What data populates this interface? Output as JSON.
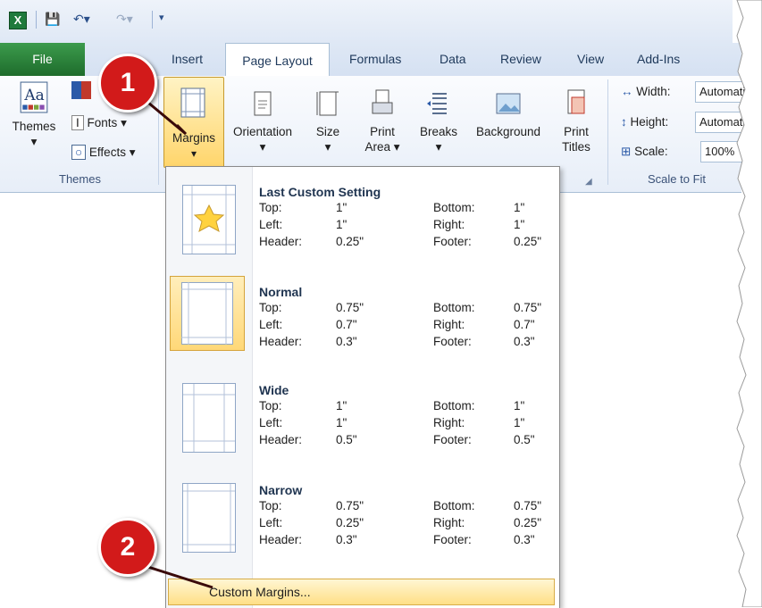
{
  "quick_access": {
    "excel_icon": "excel-icon",
    "save_icon": "save-icon",
    "undo_icon": "undo-icon",
    "redo_icon": "redo-icon"
  },
  "tabs": [
    "File",
    "Insert",
    "Page Layout",
    "Formulas",
    "Data",
    "Review",
    "View",
    "Add-Ins"
  ],
  "ribbon": {
    "themes": {
      "label": "Themes",
      "group": "Themes",
      "fonts": "Fonts",
      "effects": "Effects"
    },
    "margins": "Margins",
    "orientation": "Orientation",
    "size": "Size",
    "print_area": {
      "line1": "Print",
      "line2": "Area"
    },
    "breaks": "Breaks",
    "background": "Background",
    "print_titles": {
      "line1": "Print",
      "line2": "Titles"
    },
    "scale_to_fit": {
      "group": "Scale to Fit",
      "width_label": "Width:",
      "width_value": "Automati",
      "height_label": "Height:",
      "height_value": "Automati",
      "scale_label": "Scale:",
      "scale_value": "100%"
    }
  },
  "margins_menu": {
    "options": [
      {
        "name": "Last Custom Setting",
        "top": "1\"",
        "bottom": "1\"",
        "left": "1\"",
        "right": "1\"",
        "header": "0.25\"",
        "footer": "0.25\""
      },
      {
        "name": "Normal",
        "top": "0.75\"",
        "bottom": "0.75\"",
        "left": "0.7\"",
        "right": "0.7\"",
        "header": "0.3\"",
        "footer": "0.3\""
      },
      {
        "name": "Wide",
        "top": "1\"",
        "bottom": "1\"",
        "left": "1\"",
        "right": "1\"",
        "header": "0.5\"",
        "footer": "0.5\""
      },
      {
        "name": "Narrow",
        "top": "0.75\"",
        "bottom": "0.75\"",
        "left": "0.25\"",
        "right": "0.25\"",
        "header": "0.3\"",
        "footer": "0.3\""
      }
    ],
    "labels": {
      "top": "Top:",
      "bottom": "Bottom:",
      "left": "Left:",
      "right": "Right:",
      "header": "Header:",
      "footer": "Footer:"
    },
    "custom": "Custom Margins..."
  },
  "callouts": [
    "1",
    "2"
  ]
}
